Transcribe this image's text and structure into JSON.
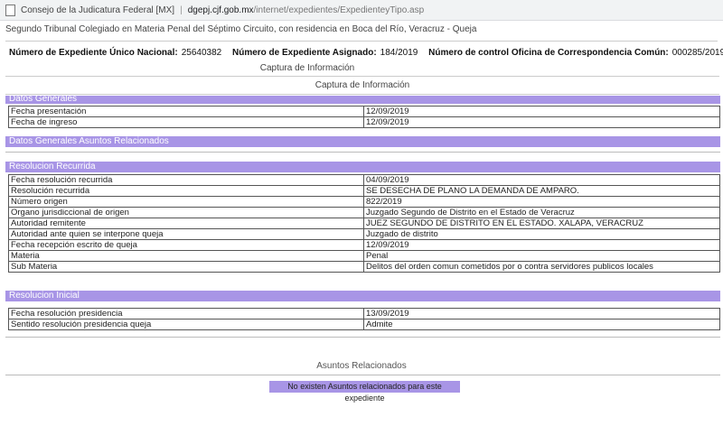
{
  "browser": {
    "tab_title": "Consejo de la Judicatura Federal [MX]",
    "url_host": "dgepj.cjf.gob.mx",
    "url_path": "/internet/expedientes/ExpedienteyTipo.asp"
  },
  "court_line": "Segundo Tribunal Colegiado en Materia Penal del Séptimo Circuito, con residencia en Boca del Río, Veracruz - Queja",
  "ids": {
    "nun_label": "Número de Expediente Único Nacional:",
    "nun_value": "25640382",
    "asignado_label": "Número de Expediente Asignado:",
    "asignado_value": "184/2019",
    "control_label": "Número de control Oficina de Correspondencia Común:",
    "control_value": "000285/2019"
  },
  "captura_label_1": "Captura de Información",
  "captura_label_2": "Captura de Información",
  "sections": {
    "datos_generales": "Datos Generales",
    "datos_relacionados": "Datos Generales Asuntos Relacionados",
    "resolucion_recurrida": "Resolucion Recurrida",
    "resolucion_inicial": "Resolucion Inicial"
  },
  "datos_generales_rows": [
    {
      "label": "Fecha presentación",
      "value": "12/09/2019"
    },
    {
      "label": "Fecha de ingreso",
      "value": "12/09/2019"
    }
  ],
  "resolucion_recurrida_rows": [
    {
      "label": "Fecha resolución recurrida",
      "value": "04/09/2019"
    },
    {
      "label": "Resolución recurrida",
      "value": "SE DESECHA DE PLANO LA DEMANDA DE AMPARO."
    },
    {
      "label": "Número origen",
      "value": "822/2019"
    },
    {
      "label": "Organo jurisdiccional de origen",
      "value": "Juzgado Segundo de Distrito en el Estado de Veracruz"
    },
    {
      "label": "Autoridad remitente",
      "value": "JUEZ SEGUNDO DE DISTRITO EN EL ESTADO. XALAPA, VERACRUZ"
    },
    {
      "label": "Autoridad ante quien se interpone queja",
      "value": "Juzgado de distrito"
    },
    {
      "label": "Fecha recepción escrito de queja",
      "value": "12/09/2019"
    },
    {
      "label": "Materia",
      "value": "Penal"
    },
    {
      "label": "Sub Materia",
      "value": "Delitos del orden comun cometidos por o contra servidores publicos locales"
    }
  ],
  "resolucion_inicial_rows": [
    {
      "label": "Fecha resolución presidencia",
      "value": "13/09/2019"
    },
    {
      "label": "Sentido resolución presidencia queja",
      "value": "Admite"
    }
  ],
  "asuntos_title": "Asuntos Relacionados",
  "no_asuntos": "No existen Asuntos relacionados para este expediente",
  "colors": {
    "section_bar": "#a895e6"
  }
}
